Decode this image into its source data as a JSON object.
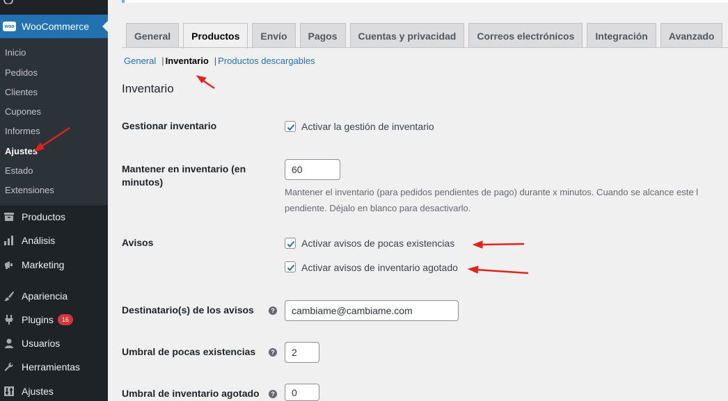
{
  "sidebar": {
    "woocommerce_label": "WooCommerce",
    "woo_logo_text": "woo",
    "submenu": [
      {
        "label": "Inicio",
        "active": false
      },
      {
        "label": "Pedidos",
        "active": false
      },
      {
        "label": "Clientes",
        "active": false
      },
      {
        "label": "Cupones",
        "active": false
      },
      {
        "label": "Informes",
        "active": false
      },
      {
        "label": "Ajustes",
        "active": true
      },
      {
        "label": "Estado",
        "active": false
      },
      {
        "label": "Extensiones",
        "active": false
      }
    ],
    "menu": [
      {
        "label": "Productos",
        "icon": "archive-icon"
      },
      {
        "label": "Análisis",
        "icon": "bar-chart-icon"
      },
      {
        "label": "Marketing",
        "icon": "megaphone-icon"
      },
      {
        "label": "Apariencia",
        "icon": "paintbrush-icon"
      },
      {
        "label": "Plugins",
        "icon": "plugin-icon",
        "badge": "16"
      },
      {
        "label": "Usuarios",
        "icon": "users-icon"
      },
      {
        "label": "Herramientas",
        "icon": "wrench-icon"
      },
      {
        "label": "Ajustes",
        "icon": "settings-icon"
      }
    ]
  },
  "tabs": [
    "General",
    "Productos",
    "Envío",
    "Pagos",
    "Cuentas y privacidad",
    "Correos electrónicos",
    "Integración",
    "Avanzado"
  ],
  "active_tab": "Productos",
  "subsections": {
    "general": "General",
    "inventario": "Inventario",
    "descargables": "Productos descargables",
    "sep": "|"
  },
  "section_title": "Inventario",
  "fields": {
    "gestionar": {
      "label": "Gestionar inventario",
      "checkbox_label": "Activar la gestión de inventario",
      "checked": true
    },
    "mantener": {
      "label": "Mantener en inventario (en minutos)",
      "value": "60",
      "description_line1": "Mantener el inventario (para pedidos pendientes de pago) durante x minutos. Cuando se alcance este l",
      "description_line2": "pendiente. Déjalo en blanco para desactivarlo."
    },
    "avisos": {
      "label": "Avisos",
      "option1": "Activar avisos de pocas existencias",
      "option2": "Activar avisos de inventario agotado",
      "checked1": true,
      "checked2": true
    },
    "destinatario": {
      "label": "Destinatario(s) de los avisos",
      "value": "cambiame@cambiame.com"
    },
    "umbral_pocas": {
      "label": "Umbral de pocas existencias",
      "value": "2"
    },
    "umbral_agotado": {
      "label": "Umbral de inventario agotado",
      "value": "0"
    }
  },
  "help_icon_glyph": "?",
  "colors": {
    "sidebar_bg": "#1d2327",
    "accent": "#2271b1",
    "annotation_arrow": "#e2231a",
    "badge": "#d63638"
  }
}
